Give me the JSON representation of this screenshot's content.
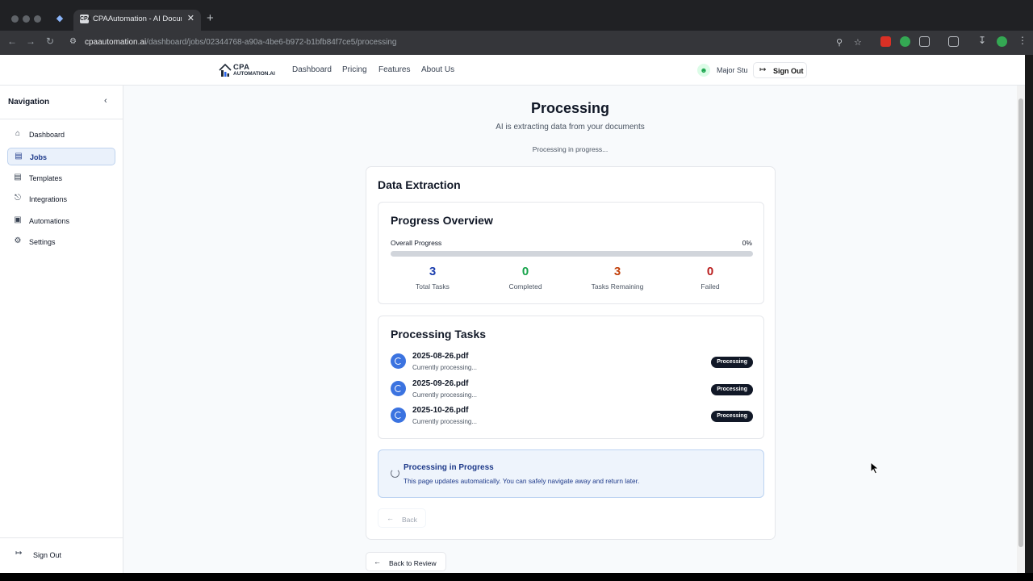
{
  "browser": {
    "tab_title": "CPAAutomation - AI Docume...",
    "tab_favicon": "CPA",
    "url_host": "cpaautomation.ai",
    "url_path": "/dashboard/jobs/02344768-a90a-4be6-b972-b1bfb84f7ce5/processing"
  },
  "topnav": {
    "logo_line1": "CPA",
    "logo_line2": "AUTOMATION.AI",
    "links": [
      "Dashboard",
      "Pricing",
      "Features",
      "About Us"
    ],
    "user_name": "Major Stu",
    "sign_out": "Sign Out"
  },
  "sidebar": {
    "title": "Navigation",
    "items": [
      {
        "label": "Dashboard",
        "icon": "home-icon"
      },
      {
        "label": "Jobs",
        "icon": "briefcase-icon",
        "active": true
      },
      {
        "label": "Templates",
        "icon": "document-icon"
      },
      {
        "label": "Integrations",
        "icon": "plug-icon"
      },
      {
        "label": "Automations",
        "icon": "bot-icon"
      },
      {
        "label": "Settings",
        "icon": "gear-icon"
      }
    ],
    "sign_out": "Sign Out"
  },
  "main": {
    "title": "Processing",
    "subtitle": "AI is extracting data from your documents",
    "status": "Processing in progress...",
    "section_title": "Data Extraction",
    "progress": {
      "title": "Progress Overview",
      "label": "Overall Progress",
      "value_text": "0%",
      "value": 0,
      "stats": [
        {
          "value": "3",
          "label": "Total Tasks",
          "color": "#1e40af"
        },
        {
          "value": "0",
          "label": "Completed",
          "color": "#16a34a"
        },
        {
          "value": "3",
          "label": "Tasks Remaining",
          "color": "#c2410c"
        },
        {
          "value": "0",
          "label": "Failed",
          "color": "#b91c1c"
        }
      ]
    },
    "tasks": {
      "title": "Processing Tasks",
      "items": [
        {
          "file": "2025-08-26.pdf",
          "status": "Currently processing...",
          "badge": "Processing"
        },
        {
          "file": "2025-09-26.pdf",
          "status": "Currently processing...",
          "badge": "Processing"
        },
        {
          "file": "2025-10-26.pdf",
          "status": "Currently processing...",
          "badge": "Processing"
        }
      ]
    },
    "info": {
      "title": "Processing in Progress",
      "text": "This page updates automatically. You can safely navigate away and return later."
    },
    "back": "Back",
    "back_to_review": "Back to Review"
  },
  "colors": {
    "accent": "#2563eb",
    "active_nav_bg": "#eaf1fb",
    "info_bg": "#eef4fc"
  }
}
